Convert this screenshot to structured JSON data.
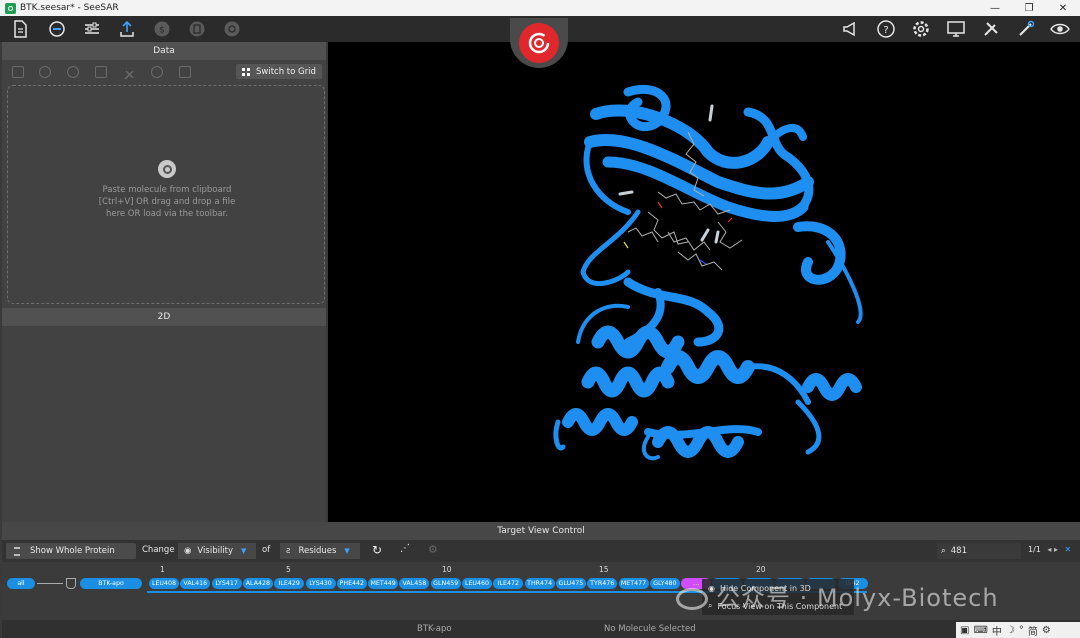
{
  "window": {
    "title": "BTK.seesar* - SeeSAR",
    "minimize": "—",
    "maximize": "❐",
    "close": "✕"
  },
  "toolbar": {
    "left_icons": [
      "file-icon",
      "compass-icon",
      "sliders-icon",
      "export-icon",
      "dollar-icon",
      "clipboard-icon",
      "target-icon"
    ],
    "right_icons": [
      "megaphone-icon",
      "help-icon",
      "settings-icon",
      "monitor-icon",
      "tools-icon",
      "wrench-icon",
      "eye-icon"
    ]
  },
  "left_panel": {
    "header": "Data",
    "switch_grid_label": "Switch to Grid",
    "drop_text": "Paste molecule from clipboard [Ctrl+V] OR drag and drop a file here OR load via the toolbar.",
    "section_2d": "2D"
  },
  "target_view": {
    "header": "Target View Control",
    "show_whole_protein": "Show Whole Protein",
    "change_label": "Change",
    "visibility_label": "Visibility",
    "of_label": "of",
    "residues_label": "Residues",
    "search_value": "481",
    "pager": "1/1",
    "all_label": "all",
    "chain_label": "BTK-apo",
    "seq_numbers": [
      "1",
      "5",
      "10",
      "15",
      "20"
    ],
    "residues": [
      "LEU408",
      "VAL416",
      "LYS417",
      "ALA428",
      "ILE429",
      "LYS430",
      "PHE442",
      "MET449",
      "VAL458",
      "GLN459",
      "LEU460",
      "ILE472",
      "THR474",
      "GLU475",
      "TYR476",
      "MET477",
      "GLY480",
      "…",
      "",
      "",
      "",
      "",
      "I542"
    ],
    "tooltip": {
      "hide": "Hide Component in 3D",
      "focus": "Focus View on This Component"
    }
  },
  "status": {
    "target": "BTK-apo",
    "molecule": "No Molecule Selected"
  },
  "watermark": "公众号 · Molyx-Biotech",
  "colors": {
    "accent": "#1a8fe3",
    "logo_red": "#e0282c",
    "protein": "#1e8ff0"
  }
}
